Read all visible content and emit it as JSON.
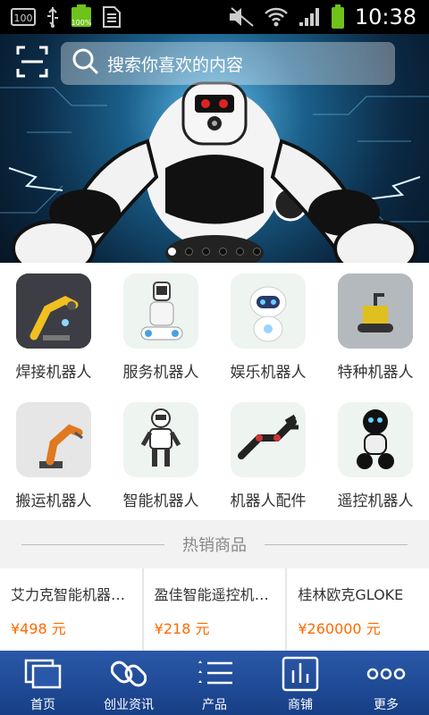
{
  "status_bar": {
    "battery_text": "100",
    "battery_level": "100%",
    "time": "10:38"
  },
  "search": {
    "placeholder": "搜索你喜欢的内容"
  },
  "banner": {
    "slide_count": 6,
    "active_slide": 0
  },
  "categories": [
    {
      "label": "焊接机器人",
      "icon": "welding-robot-icon"
    },
    {
      "label": "服务机器人",
      "icon": "service-robot-icon"
    },
    {
      "label": "娱乐机器人",
      "icon": "entertainment-robot-icon"
    },
    {
      "label": "特种机器人",
      "icon": "special-robot-icon"
    },
    {
      "label": "搬运机器人",
      "icon": "handling-robot-icon"
    },
    {
      "label": "智能机器人",
      "icon": "smart-robot-icon"
    },
    {
      "label": "机器人配件",
      "icon": "robot-parts-icon"
    },
    {
      "label": "遥控机器人",
      "icon": "remote-robot-icon"
    }
  ],
  "hot_section": {
    "title": "热销商品"
  },
  "products": [
    {
      "name": "艾力克智能机器人可对话",
      "price": "¥498 元"
    },
    {
      "name": "盈佳智能遥控机器人",
      "price": "¥218 元"
    },
    {
      "name": "桂林欧克GLOKE",
      "price": "¥260000 元"
    }
  ],
  "tabbar": [
    {
      "label": "首页",
      "icon": "home-icon"
    },
    {
      "label": "创业资讯",
      "icon": "link-icon"
    },
    {
      "label": "产品",
      "icon": "list-icon"
    },
    {
      "label": "商铺",
      "icon": "chart-icon"
    },
    {
      "label": "更多",
      "icon": "more-icon"
    }
  ],
  "colors": {
    "price": "#ff6a00",
    "tabbar": "#1f4a96"
  }
}
